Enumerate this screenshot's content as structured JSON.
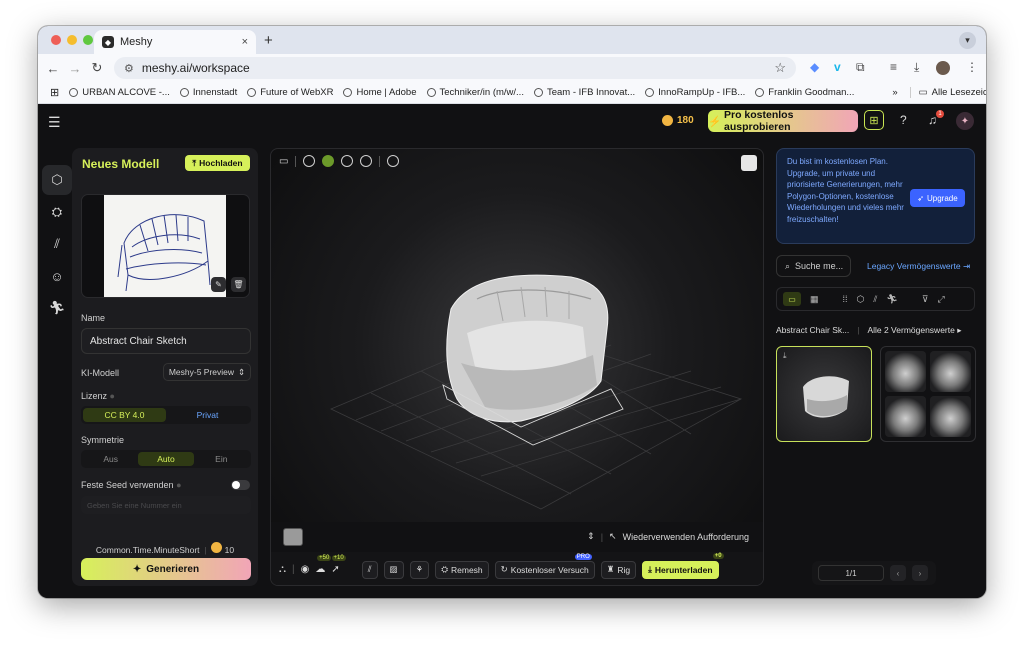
{
  "browser": {
    "tab_title": "Meshy",
    "tab_close": "×",
    "new_tab": "+",
    "url": "meshy.ai/workspace",
    "bookmarks": [
      "URBAN ALCOVE -...",
      "Innenstadt",
      "Future of WebXR",
      "Home | Adobe",
      "Techniker/in (m/w/...",
      "Team - IFB Innovat...",
      "InnoRampUp - IFB...",
      "Franklin Goodman..."
    ],
    "bookmarks_more": "»",
    "all_bookmarks": "Alle Lesezeichen"
  },
  "topbar": {
    "credits": "180",
    "pro_button": "Pro kostenlos ausprobieren",
    "notification_count": "1"
  },
  "left_panel": {
    "title": "Neues Modell",
    "upload": "Hochladen",
    "name_label": "Name",
    "name_value": "Abstract Chair Sketch",
    "ai_model_label": "KI-Modell",
    "ai_model_value": "Meshy-5 Preview",
    "license_label": "Lizenz",
    "license_options": [
      "CC BY 4.0",
      "Privat"
    ],
    "symmetry_label": "Symmetrie",
    "symmetry_options": [
      "Aus",
      "Auto",
      "Ein"
    ],
    "seed_label": "Feste Seed verwenden",
    "seed_placeholder": "Geben Sie eine Nummer ein",
    "cost_label": "Common.Time.MinuteShort",
    "cost_value": "10",
    "generate": "Generieren"
  },
  "viewport": {
    "reuse_prompt": "Wiederverwenden Aufforderung",
    "actions": {
      "plus50": "+50",
      "plus10": "+10",
      "remesh": "Remesh",
      "free_trial": "Kostenloser Versuch",
      "pro_badge": "PRO",
      "rig": "Rig",
      "download": "Herunterladen",
      "download_badge": "+0"
    }
  },
  "right_panel": {
    "upgrade_text": "Du bist im kostenlosen Plan. Upgrade, um private und priorisierte Generierungen, mehr Polygon-Optionen, kostenlose Wiederholungen und vieles mehr freizuschalten!",
    "upgrade_button": "Upgrade",
    "search_placeholder": "Suche me...",
    "legacy_link": "Legacy Vermögenswerte",
    "asset_name": "Abstract Chair Sk...",
    "all_assets": "Alle 2 Vermögenswerte",
    "pagination": "1/1"
  },
  "colors": {
    "accent": "#d6f05a",
    "link_blue": "#6aa6ff",
    "upgrade_blue": "#3b63ff",
    "background": "#111113"
  }
}
